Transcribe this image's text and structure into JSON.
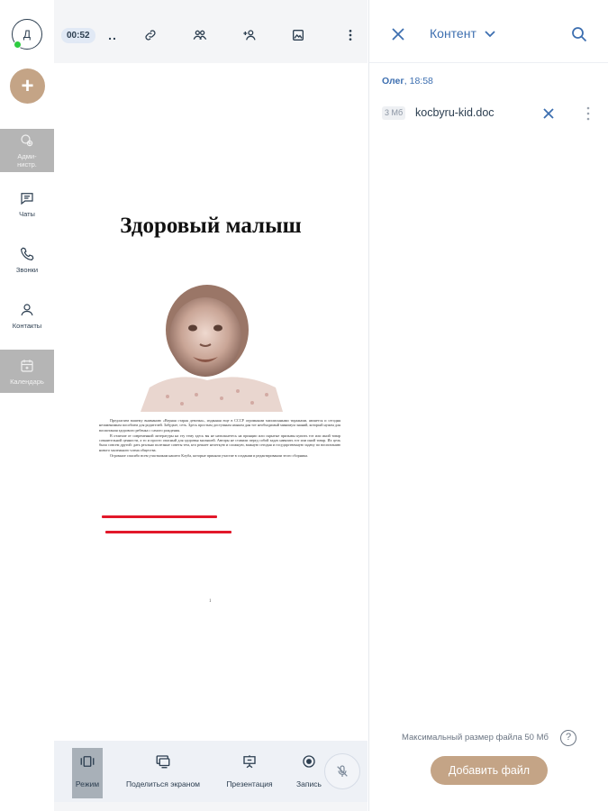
{
  "sidebar": {
    "avatar_initial": "Д",
    "add_label": "+",
    "items": [
      {
        "label": "Адми-\nнистр.",
        "icon": "admin-icon",
        "active": true
      },
      {
        "label": "Чаты",
        "icon": "chat-icon",
        "active": false
      },
      {
        "label": "Звонки",
        "icon": "phone-icon",
        "active": false
      },
      {
        "label": "Контакты",
        "icon": "contacts-icon",
        "active": false
      },
      {
        "label": "Календарь",
        "icon": "calendar-icon",
        "active": true
      }
    ]
  },
  "topbar": {
    "timer": "00:52",
    "dots": "..",
    "icons": [
      "link-icon",
      "participants-icon",
      "add-participant-icon",
      "image-icon",
      "more-vertical-icon"
    ]
  },
  "document": {
    "title": "Здоровый малыш",
    "paragraphs": [
      "Предлагаем вашему вниманию «Верная старая девочка», изданная еще в СССР огромными миллионными тиражами, является и сегодня незаменимым пособием для родителей. Забудьте, сеть. Здесь простым доступным языком дан тот необходимый минимум знаний, который нужен для воспитания здорового ребенка с самого рождения.",
      "В отличие от современной литературы на эту тему здесь вы не натолкнетесь на принцип или скрытые призывы купить тот или иной товар сомнительной ценности, а то и просто опасный для здоровья малышей. Авторы не ставили перед собой задач навязать тот или иной товар. Их цель была совсем другой: дать реально полезные советы тем, кто решает нелегкую и сложную, важную сегодня и государственную задачу по воспитанию нового маленького члена общества.",
      "Огромное спасибо всем участникам нашего Клуба, которые приняли участие в создании и редактировании этого сборника."
    ],
    "page_number": "1"
  },
  "bottombar": {
    "items": [
      {
        "label": "Режим",
        "icon": "mode-icon",
        "active": true
      },
      {
        "label": "Поделиться экраном",
        "icon": "share-screen-icon",
        "active": false
      },
      {
        "label": "Презентация",
        "icon": "presentation-icon",
        "active": false
      },
      {
        "label": "Запись",
        "icon": "record-icon",
        "active": false
      }
    ],
    "mic_icon": "mic-off-icon"
  },
  "panel": {
    "title": "Контент",
    "message": {
      "author": "Олег",
      "time": "18:58"
    },
    "file": {
      "size": "3 Мб",
      "name": "kocbyru-kid.doc"
    },
    "max_size_text": "Максимальный размер файла 50 Мб",
    "help_label": "?",
    "add_file_label": "Добавить файл"
  },
  "colors": {
    "accent_brown": "#c4a486",
    "link_blue": "#3d6fb0",
    "online_green": "#2ecc40",
    "redline": "#e2182a"
  }
}
